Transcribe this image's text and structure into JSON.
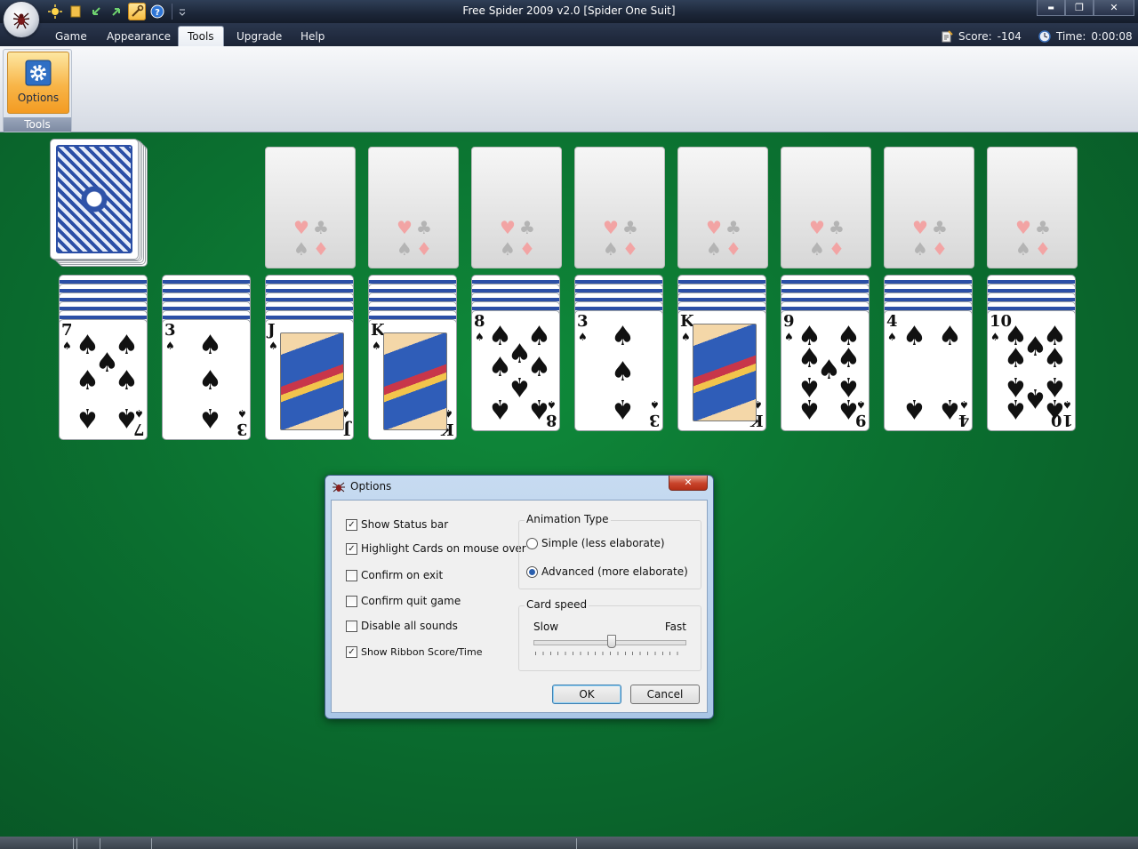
{
  "window": {
    "title": "Free Spider 2009 v2.0  [Spider One Suit]",
    "min": "▬",
    "max": "❐",
    "close": "✕"
  },
  "menu": {
    "tabs": [
      "Game",
      "Appearance",
      "Tools",
      "Upgrade",
      "Help"
    ],
    "active": "Tools"
  },
  "status": {
    "score_label": "Score:",
    "score": "-104",
    "time_label": "Time:",
    "time": "0:00:08"
  },
  "ribbon": {
    "options_label": "Options",
    "group_label": "Tools"
  },
  "tableau": [
    {
      "rank": "7",
      "face": false
    },
    {
      "rank": "3",
      "face": false
    },
    {
      "rank": "J",
      "face": true
    },
    {
      "rank": "K",
      "face": true
    },
    {
      "rank": "8",
      "face": false
    },
    {
      "rank": "3",
      "face": false
    },
    {
      "rank": "K",
      "face": true
    },
    {
      "rank": "9",
      "face": false
    },
    {
      "rank": "4",
      "face": false
    },
    {
      "rank": "10",
      "face": false
    }
  ],
  "dialog": {
    "title": "Options",
    "checkboxes": [
      {
        "label": "Show Status bar",
        "checked": true
      },
      {
        "label": "Highlight Cards on mouse over",
        "checked": true
      },
      {
        "label": "Confirm on exit",
        "checked": false
      },
      {
        "label": "Confirm quit game",
        "checked": false
      },
      {
        "label": "Disable all sounds",
        "checked": false
      },
      {
        "label": "Show Ribbon Score/Time",
        "checked": true
      }
    ],
    "animation": {
      "legend": "Animation Type",
      "simple": "Simple (less elaborate)",
      "advanced": "Advanced (more elaborate)",
      "selected": "advanced"
    },
    "speed": {
      "legend": "Card speed",
      "slow": "Slow",
      "fast": "Fast",
      "value": 0.5
    },
    "ok": "OK",
    "cancel": "Cancel"
  },
  "colors": {
    "felt": "#0b7030",
    "accent": "#f8b548"
  }
}
